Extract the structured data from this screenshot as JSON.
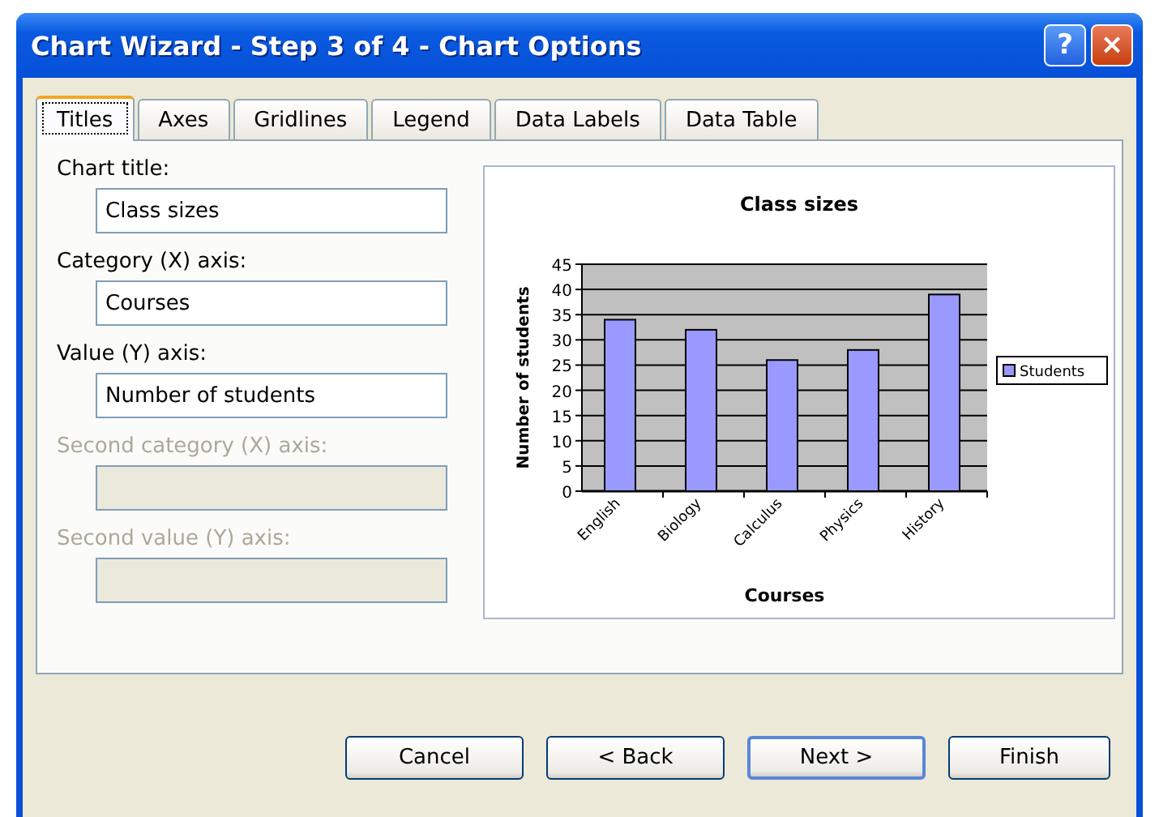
{
  "window": {
    "title": "Chart Wizard - Step 3 of 4 - Chart Options",
    "controls": [
      "?",
      "×"
    ]
  },
  "tabs": [
    {
      "label": "Titles",
      "selected": true
    },
    {
      "label": "Axes",
      "selected": false
    },
    {
      "label": "Gridlines",
      "selected": false
    },
    {
      "label": "Legend",
      "selected": false
    },
    {
      "label": "Data Labels",
      "selected": false
    },
    {
      "label": "Data Table",
      "selected": false
    }
  ],
  "fields": [
    {
      "label": "Chart title:",
      "value": "Class sizes",
      "disabled": false
    },
    {
      "label": "Category (X) axis:",
      "value": "Courses",
      "disabled": false
    },
    {
      "label": "Value (Y) axis:",
      "value": "Number of students",
      "disabled": false
    },
    {
      "label": "Second category (X) axis:",
      "disabled": true
    },
    {
      "label": "Second value (Y) axis:",
      "disabled": true
    }
  ],
  "preview": {
    "chart_data": {
      "type": "bar",
      "title": "Class sizes",
      "xlabel": "Courses",
      "ylabel": "Number of students",
      "categories": [
        "English",
        "Biology",
        "Calculus",
        "Physics",
        "History"
      ],
      "series": [
        {
          "name": "Students",
          "color": "#9999ff",
          "values": [
            34,
            32,
            26,
            28,
            39
          ]
        }
      ],
      "grid": true,
      "ylim": [
        0,
        45
      ],
      "yticks": [
        0,
        5,
        10,
        15,
        20,
        25,
        30,
        35,
        40,
        45
      ]
    }
  },
  "buttons": [
    {
      "label": "Cancel",
      "default": false
    },
    {
      "label": "< Back",
      "default": false
    },
    {
      "label": "Next >",
      "default": true
    },
    {
      "label": "Finish",
      "default": false
    }
  ]
}
